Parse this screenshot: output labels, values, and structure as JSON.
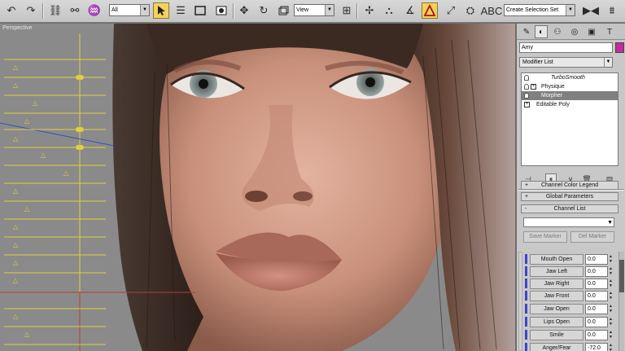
{
  "toolbar": {
    "selection_filter": "All",
    "reference_coord": "View",
    "named_selection": "Create Selection Set",
    "icons": [
      "undo-icon",
      "redo-icon",
      "link-icon",
      "unlink-icon",
      "bind-space-warp-icon",
      "select-object-icon",
      "select-by-name-icon",
      "rect-region-icon",
      "window-crossing-icon",
      "move-icon",
      "rotate-icon",
      "scale-icon",
      "use-pivot-icon",
      "manipulate-icon",
      "snap-icon",
      "angle-snap-icon",
      "percent-snap-icon",
      "spinner-snap-icon",
      "edit-named-sel-icon",
      "mirror-icon",
      "align-icon"
    ]
  },
  "viewport": {
    "label": "Perspective",
    "colors": {
      "hair": "#3b2a22",
      "skin": "#c8907a",
      "grid": "#e0d040",
      "background": "#8a8a8a"
    }
  },
  "panel": {
    "tabs": [
      "create-tab-icon",
      "modify-tab-icon",
      "hierarchy-tab-icon",
      "motion-tab-icon",
      "display-tab-icon",
      "utilities-tab-icon"
    ],
    "object_name": "Amy",
    "object_color": "#c62a9b",
    "modifier_list": "Modifier List",
    "stack": [
      {
        "label": "TurboSmooth",
        "selected": false,
        "italic": true
      },
      {
        "label": "Physique",
        "selected": false,
        "italic": false
      },
      {
        "label": "Morpher",
        "selected": true,
        "italic": false
      },
      {
        "label": "Editable Poly",
        "selected": false,
        "italic": false
      }
    ],
    "rollouts": {
      "color_legend": "Channel Color Legend",
      "global_params": "Global Parameters",
      "channel_list": "Channel List"
    },
    "save_marker": "Save Marker",
    "del_marker": "Del Marker",
    "channels": [
      {
        "name": "Mouth Open",
        "value": "0.0"
      },
      {
        "name": "Jaw Left",
        "value": "0.0"
      },
      {
        "name": "Jaw Right",
        "value": "0.0"
      },
      {
        "name": "Jaw Front",
        "value": "0.0"
      },
      {
        "name": "Jaw Open",
        "value": "0.0"
      },
      {
        "name": "Lips Open",
        "value": "0.0"
      },
      {
        "name": "Smile",
        "value": "0.0"
      },
      {
        "name": "Anger/Fear",
        "value": "-72.0"
      }
    ]
  }
}
